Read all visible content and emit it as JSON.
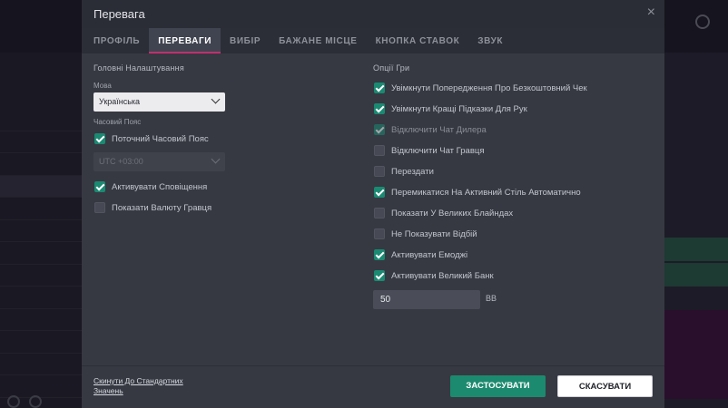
{
  "modal": {
    "title": "Перевага",
    "close_label": "×"
  },
  "tabs": [
    {
      "label": "ПРОФІЛЬ",
      "active": false
    },
    {
      "label": "ПЕРЕВАГИ",
      "active": true
    },
    {
      "label": "ВИБІР",
      "active": false
    },
    {
      "label": "БАЖАНЕ МІСЦЕ",
      "active": false
    },
    {
      "label": "КНОПКА СТАВОК",
      "active": false
    },
    {
      "label": "ЗВУК",
      "active": false
    }
  ],
  "general": {
    "title": "Головні Налаштування",
    "language_label": "Мова",
    "language_value": "Українська",
    "timezone_label": "Часовий Пояс",
    "current_timezone": {
      "label": "Поточний Часовий Пояс",
      "checked": true
    },
    "timezone_value": "UTC +03:00",
    "notifications": {
      "label": "Активувати Сповіщення",
      "checked": true
    },
    "player_currency": {
      "label": "Показати Валюту Гравця",
      "checked": false
    }
  },
  "game_options": {
    "title": "Опції Гри",
    "items": [
      {
        "label": "Увімкнути Попередження Про Безкоштовний Чек",
        "checked": true,
        "dim": false
      },
      {
        "label": "Увімкнути Кращі Підказки Для Рук",
        "checked": true,
        "dim": false
      },
      {
        "label": "Відключити Чат Дилера",
        "checked": true,
        "dim": true
      },
      {
        "label": "Відключити Чат Гравця",
        "checked": false,
        "dim": false
      },
      {
        "label": "Перездати",
        "checked": false,
        "dim": false
      },
      {
        "label": "Перемикатися На Активний Стіль Автоматично",
        "checked": true,
        "dim": false
      },
      {
        "label": "Показати У Великих Блайндах",
        "checked": false,
        "dim": false
      },
      {
        "label": "Не Показувати Відбій",
        "checked": false,
        "dim": false
      },
      {
        "label": "Активувати Емоджі",
        "checked": true,
        "dim": false
      },
      {
        "label": "Активувати Великий Банк",
        "checked": true,
        "dim": false
      }
    ],
    "big_pot_value": "50",
    "big_pot_unit": "BB"
  },
  "footer": {
    "reset_label": "Скинути До Стандартних Значень",
    "apply_label": "ЗАСТОСУВАТИ",
    "cancel_label": "СКАСУВАТИ"
  },
  "colors": {
    "accent_tab": "#c0306f",
    "checkbox_checked": "#1a8a72",
    "apply_button": "#1c8a6e"
  }
}
